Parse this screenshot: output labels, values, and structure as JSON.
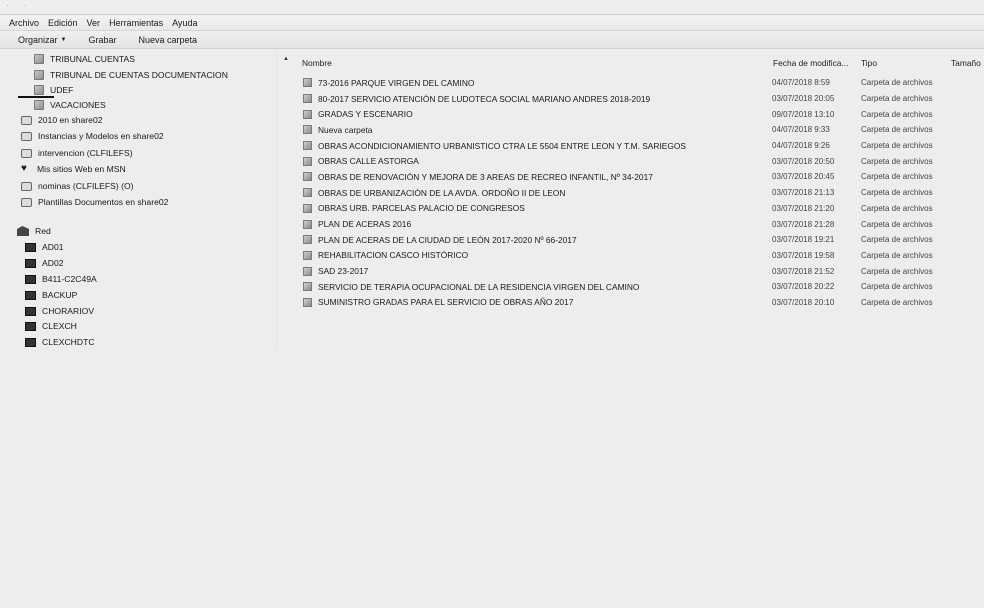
{
  "window": {
    "menu": [
      "Archivo",
      "Edición",
      "Ver",
      "Herramientas",
      "Ayuda"
    ]
  },
  "toolbar": {
    "organize_label": "Organizar",
    "burn_label": "Grabar",
    "new_folder_label": "Nueva carpeta"
  },
  "nav": {
    "folders": [
      "TRIBUNAL CUENTAS",
      "TRIBUNAL DE CUENTAS DOCUMENTACION",
      "UDEF",
      "VACACIONES"
    ],
    "selected_folder": "UDEF",
    "locations": [
      {
        "label": "2010 en share02",
        "icon": "network-drive-icon"
      },
      {
        "label": "Instancias y Modelos en share02",
        "icon": "network-drive-icon"
      },
      {
        "label": "intervencion (CLFILEFS)",
        "icon": "network-drive-icon"
      },
      {
        "label": "Mis sitios Web en MSN",
        "icon": "msn-icon"
      },
      {
        "label": "nominas (CLFILEFS) (O)",
        "icon": "network-drive-icon"
      },
      {
        "label": "Plantillas Documentos en share02",
        "icon": "network-drive-icon"
      }
    ],
    "network_label": "Red",
    "computers": [
      "AD01",
      "AD02",
      "B411-C2C49A",
      "BACKUP",
      "CHORARIOV",
      "CLEXCH",
      "CLEXCHDTC"
    ]
  },
  "list": {
    "columns": {
      "name": "Nombre",
      "date": "Fecha de modifica...",
      "type": "Tipo",
      "size": "Tamaño"
    },
    "rows": [
      {
        "name": "73-2016 PARQUE VIRGEN DEL CAMINO",
        "date": "04/07/2018 8:59",
        "type": "Carpeta de archivos"
      },
      {
        "name": "80-2017 SERVICIO ATENCIÓN DE LUDOTECA SOCIAL MARIANO ANDRES 2018-2019",
        "date": "03/07/2018 20:05",
        "type": "Carpeta de archivos"
      },
      {
        "name": "GRADAS Y ESCENARIO",
        "date": "09/07/2018 13:10",
        "type": "Carpeta de archivos"
      },
      {
        "name": "Nueva carpeta",
        "date": "04/07/2018 9:33",
        "type": "Carpeta de archivos"
      },
      {
        "name": "OBRAS ACONDICIONAMIENTO URBANISTICO CTRA LE 5504 ENTRE LEON Y T.M. SARIEGOS",
        "date": "04/07/2018 9:26",
        "type": "Carpeta de archivos"
      },
      {
        "name": "OBRAS CALLE ASTORGA",
        "date": "03/07/2018 20:50",
        "type": "Carpeta de archivos"
      },
      {
        "name": "OBRAS DE RENOVACIÓN Y MEJORA DE 3 AREAS DE RECREO INFANTIL, Nº 34-2017",
        "date": "03/07/2018 20:45",
        "type": "Carpeta de archivos"
      },
      {
        "name": "OBRAS DE URBANIZACIÓN DE LA AVDA. ORDOÑO II DE LEON",
        "date": "03/07/2018 21:13",
        "type": "Carpeta de archivos"
      },
      {
        "name": "OBRAS URB. PARCELAS PALACIO DE CONGRESOS",
        "date": "03/07/2018 21:20",
        "type": "Carpeta de archivos"
      },
      {
        "name": "PLAN DE ACERAS 2016",
        "date": "03/07/2018 21:28",
        "type": "Carpeta de archivos"
      },
      {
        "name": "PLAN DE ACERAS DE LA CIUDAD DE LEÓN 2017-2020 Nº 66-2017",
        "date": "03/07/2018 19:21",
        "type": "Carpeta de archivos"
      },
      {
        "name": "REHABILITACION CASCO HISTÓRICO",
        "date": "03/07/2018 19:58",
        "type": "Carpeta de archivos"
      },
      {
        "name": "SAD 23-2017",
        "date": "03/07/2018 21:52",
        "type": "Carpeta de archivos"
      },
      {
        "name": "SERVICIO DE TERAPIA OCUPACIONAL DE LA RESIDENCIA VIRGEN DEL CAMINO",
        "date": "03/07/2018 20:22",
        "type": "Carpeta de archivos"
      },
      {
        "name": "SUMINISTRO GRADAS PARA EL SERVICIO DE OBRAS AÑO 2017",
        "date": "03/07/2018 20:10",
        "type": "Carpeta de archivos"
      }
    ]
  }
}
